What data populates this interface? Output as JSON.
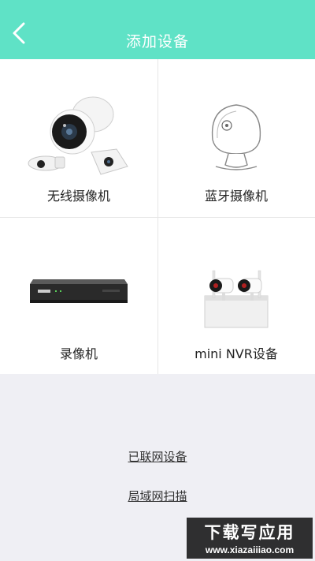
{
  "header": {
    "title": "添加设备",
    "back_icon": "chevron-left-icon",
    "background_color": "#5fe2c6"
  },
  "devices": [
    {
      "label": "无线摄像机",
      "icon": "wireless-camera-image"
    },
    {
      "label": "蓝牙摄像机",
      "icon": "bluetooth-camera-image"
    },
    {
      "label": "录像机",
      "icon": "recorder-image"
    },
    {
      "label": "mini NVR设备",
      "icon": "mini-nvr-image"
    }
  ],
  "links": {
    "networked_devices": "已联网设备",
    "lan_scan": "局域网扫描"
  },
  "watermark": {
    "line1": "下载写应用",
    "line2": "www.xiazaiiiao.com"
  }
}
